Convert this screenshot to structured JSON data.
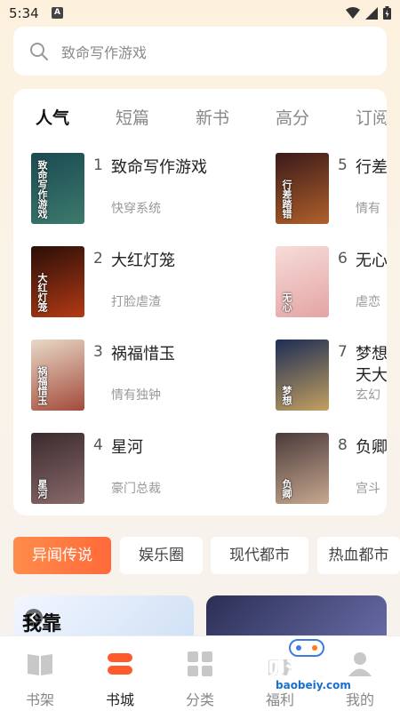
{
  "status": {
    "time": "5:34",
    "notif_letter": "A"
  },
  "search": {
    "placeholder": "致命写作游戏"
  },
  "tabs": [
    "人气",
    "短篇",
    "新书",
    "高分",
    "订阅"
  ],
  "books": [
    {
      "rank": "1",
      "title": "致命写作游戏",
      "tag": "快穿系统",
      "cover_colors": [
        "#1b4a52",
        "#3c7a6c"
      ],
      "cover_text": "致命写作游戏"
    },
    {
      "rank": "2",
      "title": "大红灯笼",
      "tag": "打脸虐渣",
      "cover_colors": [
        "#2a0e08",
        "#b33a14"
      ],
      "cover_text": "大红灯笼"
    },
    {
      "rank": "3",
      "title": "祸福惜玉",
      "tag": "情有独钟",
      "cover_colors": [
        "#e9d9c8",
        "#a34a3a"
      ],
      "cover_text": "祸福惜玉"
    },
    {
      "rank": "4",
      "title": "星河",
      "tag": "豪门总裁",
      "cover_colors": [
        "#3a2a2e",
        "#8a6a6a"
      ],
      "cover_text": "星河"
    },
    {
      "rank": "5",
      "title": "行差",
      "tag": "情有",
      "cover_colors": [
        "#3a1a1a",
        "#b0602a"
      ],
      "cover_text": "行差踏错"
    },
    {
      "rank": "6",
      "title": "无心",
      "tag": "虐恋",
      "cover_colors": [
        "#f6dcd8",
        "#e4a4a4"
      ],
      "cover_text": "无心"
    },
    {
      "rank": "7",
      "title": "梦想",
      "title_line2": "天大",
      "tag": "玄幻",
      "cover_colors": [
        "#1c2d55",
        "#c4a060"
      ],
      "cover_text": "梦想"
    },
    {
      "rank": "8",
      "title": "负卿",
      "tag": "宫斗",
      "cover_colors": [
        "#4a3a3a",
        "#c8a890"
      ],
      "cover_text": "负卿"
    }
  ],
  "categories": [
    "异闻传说",
    "娱乐圈",
    "现代都市",
    "热血都市"
  ],
  "banners": [
    {
      "text": "我靠",
      "colors": [
        "#f2f6ff",
        "#cfe0f5"
      ]
    },
    {
      "text": "",
      "colors": [
        "#2b2f55",
        "#6a6da8"
      ]
    }
  ],
  "nav": [
    {
      "label": "书架",
      "icon": "book-icon"
    },
    {
      "label": "书城",
      "icon": "store-icon"
    },
    {
      "label": "分类",
      "icon": "grid-icon"
    },
    {
      "label": "福利",
      "icon": "gift-icon"
    },
    {
      "label": "我的",
      "icon": "user-icon"
    }
  ],
  "watermark": {
    "text": "宝贝游戏网",
    "url": "baobeiy.com"
  },
  "colors": {
    "accent": "#ff6a3a",
    "nav_active": "#ff5a2a"
  }
}
